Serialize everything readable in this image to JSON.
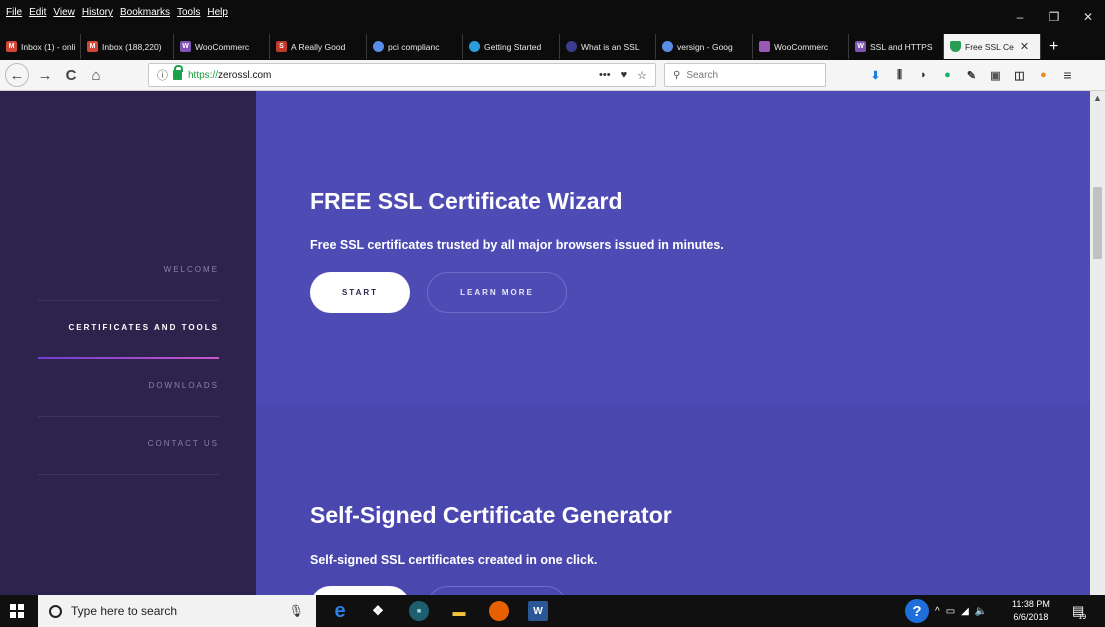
{
  "menu": [
    "File",
    "Edit",
    "View",
    "History",
    "Bookmarks",
    "Tools",
    "Help"
  ],
  "window_controls": {
    "minimize": "–",
    "restore": "❐",
    "close": "✕"
  },
  "tabs": [
    {
      "label": "Inbox (1) - onli",
      "icon": "gmail-icon",
      "color": "#d44638",
      "glyph": "M"
    },
    {
      "label": "Inbox (188,220)",
      "icon": "gmail-icon",
      "color": "#d44638",
      "glyph": "M"
    },
    {
      "label": "WooCommerc",
      "icon": "woocommerce-icon",
      "color": "#7f54b3",
      "glyph": "W"
    },
    {
      "label": "A Really Good",
      "icon": "s-site-icon",
      "color": "#c0392b",
      "glyph": "S"
    },
    {
      "label": "pci complianc",
      "icon": "chrome-like-icon",
      "color": "#5a8de8",
      "glyph": "◎"
    },
    {
      "label": "Getting Started",
      "icon": "globe-icon",
      "color": "#2d9cdb",
      "glyph": "●"
    },
    {
      "label": "What is an SSL",
      "icon": "site-icon",
      "color": "#3b3b8f",
      "glyph": "◉"
    },
    {
      "label": "versign - Goog",
      "icon": "google-icon",
      "color": "#5a8de8",
      "glyph": "◎"
    },
    {
      "label": "WooCommerc",
      "icon": "woocommerce-icon",
      "color": "#9b59b6",
      "glyph": "◼"
    },
    {
      "label": "SSL and HTTPS",
      "icon": "woocommerce-icon",
      "color": "#7f54b3",
      "glyph": "W"
    },
    {
      "label": "Free SSL Ce",
      "icon": "shield-icon",
      "color": "#2a9d55",
      "glyph": "▼",
      "active": true
    }
  ],
  "nav": {
    "back": "←",
    "forward": "→",
    "reload": "C",
    "home": "⌂",
    "url_protocol": "https://",
    "url_host": "zerossl.com",
    "page_actions": "•••",
    "search_placeholder": "Search"
  },
  "sidebar": {
    "items": [
      {
        "label": "WELCOME"
      },
      {
        "label": "CERTIFICATES AND TOOLS",
        "active": true
      },
      {
        "label": "DOWNLOADS"
      },
      {
        "label": "CONTACT US"
      }
    ]
  },
  "sections": [
    {
      "title": "FREE SSL Certificate Wizard",
      "subtitle": "Free SSL certificates trusted by all major browsers issued in minutes.",
      "start": "START",
      "learn": "LEARN MORE"
    },
    {
      "title": "Self-Signed Certificate Generator",
      "subtitle": "Self-signed SSL certificates created in one click."
    }
  ],
  "taskbar": {
    "search_placeholder": "Type here to search",
    "time": "11:38 PM",
    "date": "6/6/2018",
    "notifications": "19"
  },
  "colors": {
    "sidebar_bg": "#2e234d",
    "main_bg": "#4e4cb4",
    "accent_start": "#6e3fd2",
    "accent_end": "#c957c9"
  }
}
